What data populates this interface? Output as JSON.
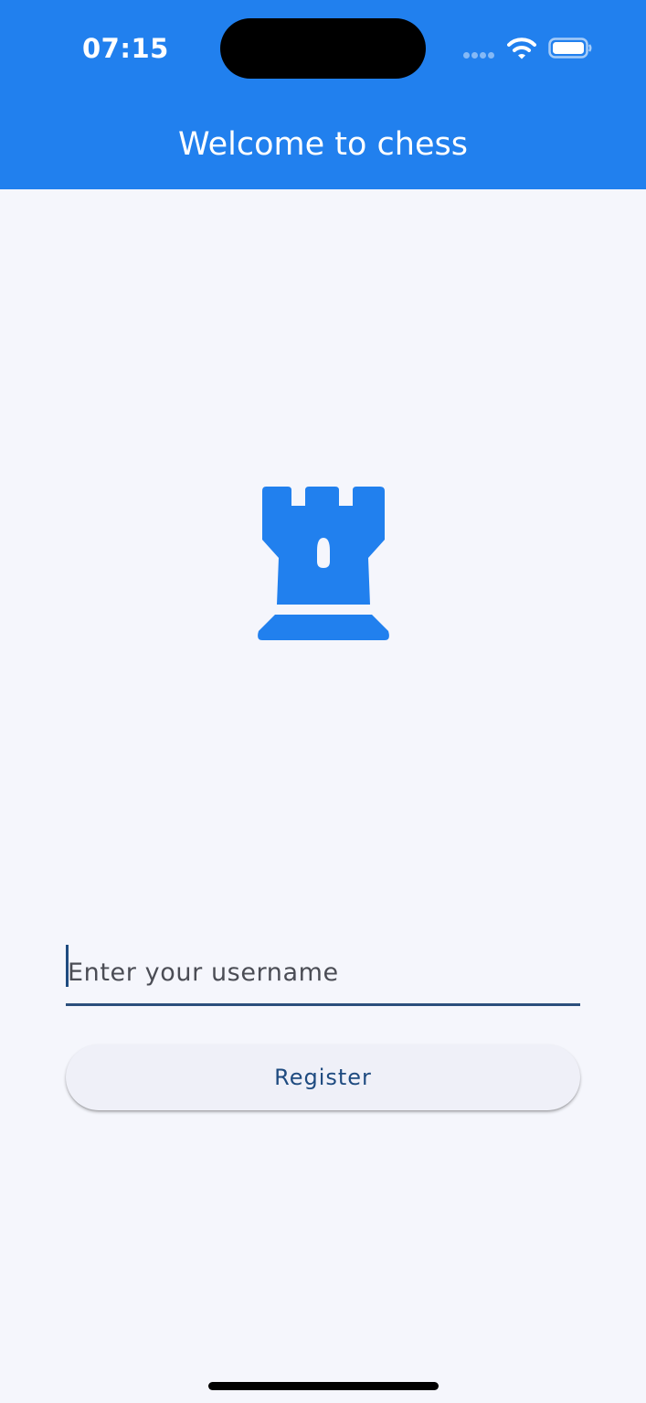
{
  "status_bar": {
    "time": "07:15"
  },
  "app_bar": {
    "title": "Welcome to chess"
  },
  "logo": {
    "icon": "chess-rook-icon"
  },
  "form": {
    "username_placeholder": "Enter your username",
    "username_value": "",
    "register_label": "Register"
  },
  "colors": {
    "primary": "#2180ee",
    "background": "#f5f6fc",
    "button_text": "#1f4b80"
  }
}
